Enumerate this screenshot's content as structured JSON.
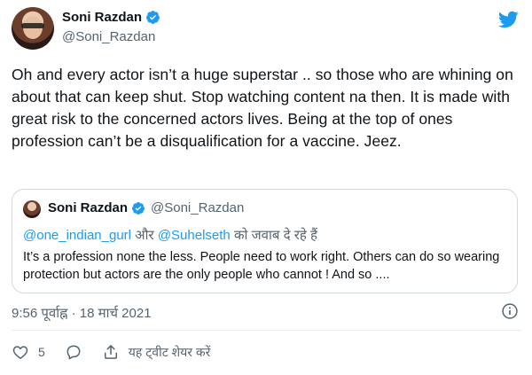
{
  "author": {
    "name": "Soni Razdan",
    "handle": "@Soni_Razdan"
  },
  "tweet": {
    "text": "Oh and every actor isn’t a huge superstar .. so those who are whining on about that can keep shut. Stop watching content na then. It is made with great risk to the concerned actors lives. Being at the top of ones profession can’t be a disqualification for a vaccine. Jeez.",
    "timestamp": "9:56 पूर्वाह्न · 18 मार्च 2021"
  },
  "quoted": {
    "name": "Soni Razdan",
    "handle": "@Soni_Razdan",
    "reply_mention_1": "@one_indian_gurl",
    "reply_and": " और ",
    "reply_mention_2": "@Suhelseth",
    "reply_suffix": " को जवाब दे रहे हैं",
    "text": "It’s a profession none the less. People need to work right. Others can do so wearing protection but actors are the only people who cannot ! And so ...."
  },
  "actions": {
    "like_count": "5",
    "share_label": "यह ट्वीट शेयर करें"
  },
  "icons": {
    "brand": "twitter-icon",
    "verified": "verified-badge-icon",
    "info": "info-icon",
    "like": "heart-icon",
    "reply": "reply-icon",
    "share": "share-icon"
  },
  "colors": {
    "brand": "#1d9bf0",
    "secondary_text": "#536471",
    "border": "#cfd9de"
  }
}
